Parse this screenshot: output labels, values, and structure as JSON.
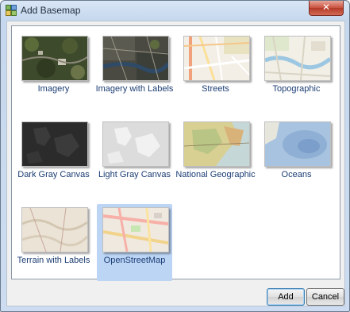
{
  "window": {
    "title": "Add Basemap",
    "close_glyph": "✕"
  },
  "basemaps": [
    {
      "label": "Imagery",
      "selected": false
    },
    {
      "label": "Imagery with Labels",
      "selected": false
    },
    {
      "label": "Streets",
      "selected": false
    },
    {
      "label": "Topographic",
      "selected": false
    },
    {
      "label": "Dark Gray Canvas",
      "selected": false
    },
    {
      "label": "Light Gray Canvas",
      "selected": false
    },
    {
      "label": "National Geographic",
      "selected": false
    },
    {
      "label": "Oceans",
      "selected": false
    },
    {
      "label": "Terrain with Labels",
      "selected": false
    },
    {
      "label": "OpenStreetMap",
      "selected": true
    }
  ],
  "buttons": {
    "add": "Add",
    "cancel": "Cancel"
  },
  "colors": {
    "selection": "#bcd5f5",
    "label_text": "#1b3d73"
  }
}
